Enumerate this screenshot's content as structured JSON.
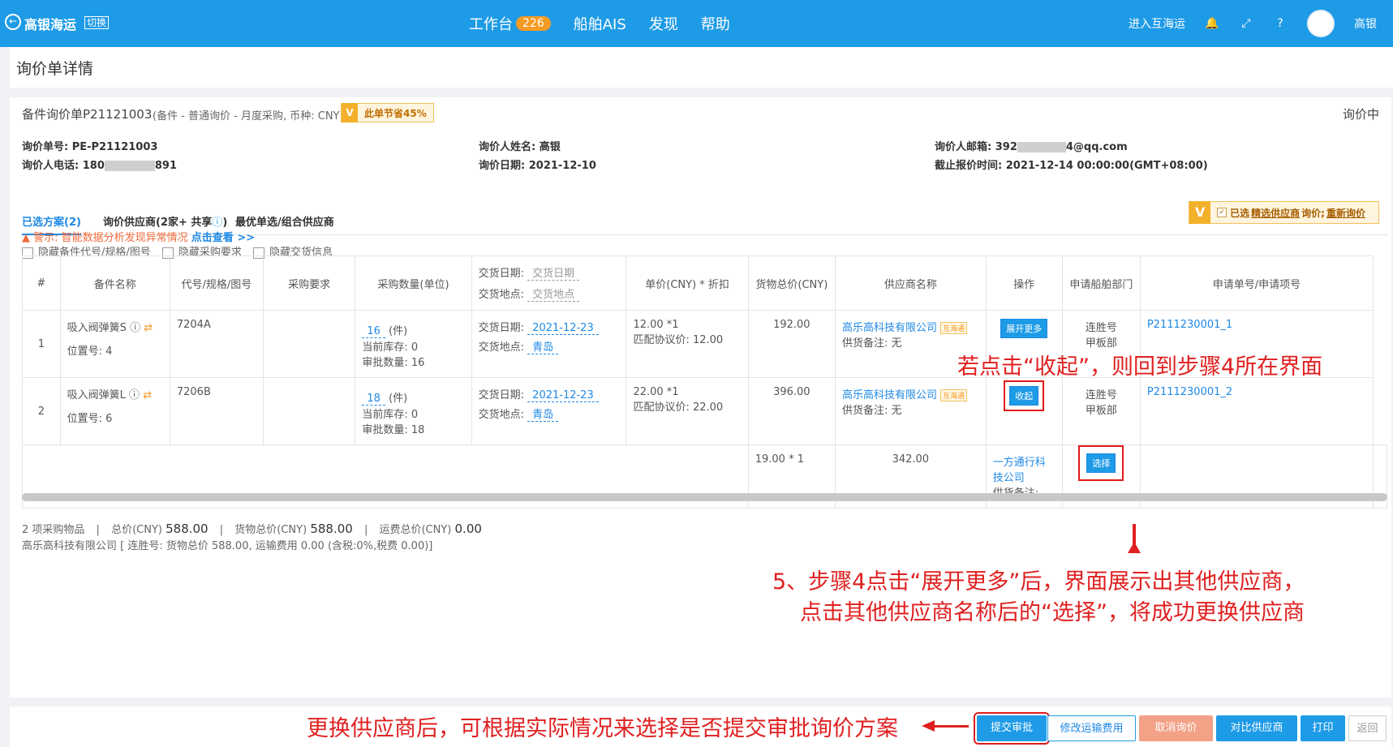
{
  "topbar": {
    "brand": "高银海运",
    "switch": "切换",
    "nav": [
      {
        "label": "工作台",
        "badge": "226"
      },
      {
        "label": "船舶AIS"
      },
      {
        "label": "发现"
      },
      {
        "label": "帮助"
      }
    ],
    "enter_hu": "进入互海运",
    "username": "高银"
  },
  "page": {
    "title": "询价单详情"
  },
  "header": {
    "title": "备件询价单P21121003",
    "meta": "(备件 - 普通询价 - 月度采购, 币种: CNY)",
    "save_badge": "此单节省45%",
    "status": "询价中"
  },
  "info": {
    "order_no": "询价单号: PE-P21121003",
    "phone": "询价人电话: 180",
    "phone_tail": "891",
    "name": "询价人姓名: 高银",
    "date": "询价日期: 2021-12-10",
    "email": "询价人邮箱: 392",
    "email_tail": "4@qq.com",
    "deadline": "截止报价时间: 2021-12-14 00:00:00(GMT+08:00)"
  },
  "tabs": [
    {
      "label": "已选方案(2)"
    },
    {
      "label": "询价供应商(2家+ 共享"
    },
    {
      "label": "最优单选/组合供应商"
    }
  ],
  "notice": {
    "pre": "已选",
    "link1": "精选供应商",
    "mid": "询价;",
    "link2": "重新询价"
  },
  "warning": {
    "text": "警示: 智能数据分析发现异常情况",
    "link": "点击查看 >>"
  },
  "filters": [
    "隐藏备件代号/规格/图号",
    "隐藏采购要求",
    "隐藏交货信息"
  ],
  "table": {
    "headers": [
      "#",
      "备件名称",
      "代号/规格/图号",
      "采购要求",
      "采购数量(单位)",
      "交货日期:",
      "交货地点:",
      "单价(CNY) * 折扣",
      "货物总价(CNY)",
      "供应商名称",
      "操作",
      "申请船舶部门",
      "申请单号/申请项号"
    ],
    "header_delivery_date_placeholder": "交货日期",
    "header_delivery_place_placeholder": "交货地点",
    "rows": [
      {
        "no": "1",
        "name": "吸入阀弹簧S",
        "position": "位置号: 4",
        "code": "7204A",
        "qty": "16",
        "unit": "(件)",
        "stock": "当前库存: 0",
        "approve": "审批数量: 16",
        "date_label": "交货日期:",
        "date": "2021-12-23",
        "place_label": "交货地点:",
        "place": "青岛",
        "price": "12.00 *1",
        "match": "匹配协议价:",
        "match_val": "12.00",
        "total": "192.00",
        "supplier": "高乐高科技有限公司",
        "supplier_tag": "互海通",
        "supply_note": "供货备注: 无",
        "op": "展开更多",
        "ship": "连胜号",
        "dept": "甲板部",
        "apply_no": "P2111230001_1"
      },
      {
        "no": "2",
        "name": "吸入阀弹簧L",
        "position": "位置号: 6",
        "code": "7206B",
        "qty": "18",
        "unit": "(件)",
        "stock": "当前库存: 0",
        "approve": "审批数量: 18",
        "date_label": "交货日期:",
        "date": "2021-12-23",
        "place_label": "交货地点:",
        "place": "青岛",
        "price": "22.00 *1",
        "match": "匹配协议价:",
        "match_val": "22.00",
        "total": "396.00",
        "supplier": "高乐高科技有限公司",
        "supplier_tag": "互海通",
        "supply_note": "供货备注: 无",
        "op": "收起",
        "ship": "连胜号",
        "dept": "甲板部",
        "apply_no": "P2111230001_2"
      }
    ],
    "alt": {
      "price": "19.00 * 1",
      "total": "342.00",
      "supplier": "一方通行科技公司",
      "supply_note": "供货备注:",
      "op": "选择"
    }
  },
  "summary": {
    "line1_a": "2 项采购物品",
    "line1_b": "总价(CNY)",
    "line1_b_val": "588.00",
    "line1_c": "货物总价(CNY)",
    "line1_c_val": "588.00",
    "line1_d": "运费总价(CNY)",
    "line1_d_val": "0.00",
    "line2": "高乐高科技有限公司 [ 连胜号: 货物总价 588.00, 运输费用 0.00 (含税:0%,税费 0.00)]"
  },
  "annotations": {
    "a1": "若点击“收起”，则回到步骤4所在界面",
    "a2": "5、步骤4点击“展开更多”后，界面展示出其他供应商，",
    "a3": "点击其他供应商名称后的“选择”，将成功更换供应商",
    "a4": "更换供应商后，可根据实际情况来选择是否提交审批询价方案"
  },
  "footer": {
    "submit": "提交审批",
    "modify": "修改运输费用",
    "cancel": "取消询价",
    "compare": "对比供应商",
    "print": "打印",
    "back": "返回"
  }
}
